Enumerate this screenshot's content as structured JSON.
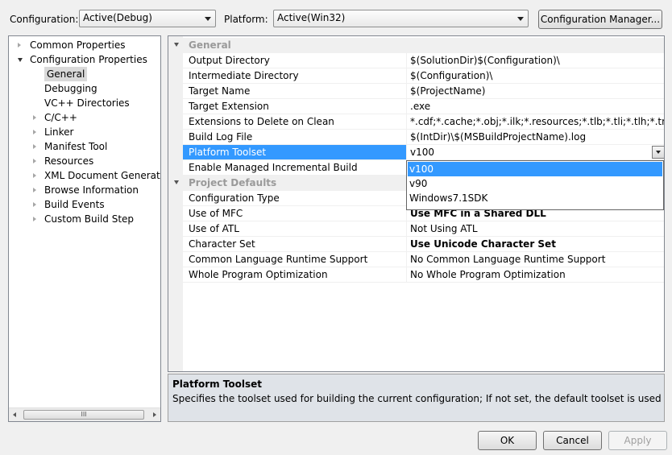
{
  "toolbar": {
    "configuration_label": "Configuration:",
    "configuration_value": "Active(Debug)",
    "platform_label": "Platform:",
    "platform_value": "Active(Win32)",
    "config_manager_button": "Configuration Manager..."
  },
  "tree": {
    "items": [
      {
        "label": "Common Properties",
        "level": 0,
        "expander": "collapsed"
      },
      {
        "label": "Configuration Properties",
        "level": 0,
        "expander": "expanded"
      },
      {
        "label": "General",
        "level": 1,
        "expander": "none",
        "selected": true
      },
      {
        "label": "Debugging",
        "level": 1,
        "expander": "none"
      },
      {
        "label": "VC++ Directories",
        "level": 1,
        "expander": "none"
      },
      {
        "label": "C/C++",
        "level": 1,
        "expander": "collapsed"
      },
      {
        "label": "Linker",
        "level": 1,
        "expander": "collapsed"
      },
      {
        "label": "Manifest Tool",
        "level": 1,
        "expander": "collapsed"
      },
      {
        "label": "Resources",
        "level": 1,
        "expander": "collapsed"
      },
      {
        "label": "XML Document Generator",
        "level": 1,
        "expander": "collapsed"
      },
      {
        "label": "Browse Information",
        "level": 1,
        "expander": "collapsed"
      },
      {
        "label": "Build Events",
        "level": 1,
        "expander": "collapsed"
      },
      {
        "label": "Custom Build Step",
        "level": 1,
        "expander": "collapsed"
      }
    ],
    "scroll_thumb": "III"
  },
  "grid": {
    "rows": [
      {
        "kind": "category",
        "name": "General"
      },
      {
        "kind": "prop",
        "name": "Output Directory",
        "value": "$(SolutionDir)$(Configuration)\\"
      },
      {
        "kind": "prop",
        "name": "Intermediate Directory",
        "value": "$(Configuration)\\"
      },
      {
        "kind": "prop",
        "name": "Target Name",
        "value": "$(ProjectName)"
      },
      {
        "kind": "prop",
        "name": "Target Extension",
        "value": ".exe"
      },
      {
        "kind": "prop",
        "name": "Extensions to Delete on Clean",
        "value": "*.cdf;*.cache;*.obj;*.ilk;*.resources;*.tlb;*.tli;*.tlh;*.tmp;*.rsp;*"
      },
      {
        "kind": "prop",
        "name": "Build Log File",
        "value": "$(IntDir)\\$(MSBuildProjectName).log"
      },
      {
        "kind": "prop",
        "name": "Platform Toolset",
        "value": "v100",
        "selected": true
      },
      {
        "kind": "prop",
        "name": "Enable Managed Incremental Build",
        "value": ""
      },
      {
        "kind": "category",
        "name": "Project Defaults"
      },
      {
        "kind": "prop",
        "name": "Configuration Type",
        "value": ""
      },
      {
        "kind": "prop",
        "name": "Use of MFC",
        "value": "Use MFC in a Shared DLL",
        "bold": true
      },
      {
        "kind": "prop",
        "name": "Use of ATL",
        "value": "Not Using ATL"
      },
      {
        "kind": "prop",
        "name": "Character Set",
        "value": "Use Unicode Character Set",
        "bold": true
      },
      {
        "kind": "prop",
        "name": "Common Language Runtime Support",
        "value": "No Common Language Runtime Support"
      },
      {
        "kind": "prop",
        "name": "Whole Program Optimization",
        "value": "No Whole Program Optimization"
      }
    ]
  },
  "dropdown": {
    "options": [
      "v100",
      "v90",
      "Windows7.1SDK"
    ],
    "selected_index": 0
  },
  "description": {
    "title": "Platform Toolset",
    "text": "Specifies the toolset used for building the current configuration; If not set, the default toolset is used"
  },
  "buttons": {
    "ok": "OK",
    "cancel": "Cancel",
    "apply": "Apply"
  }
}
